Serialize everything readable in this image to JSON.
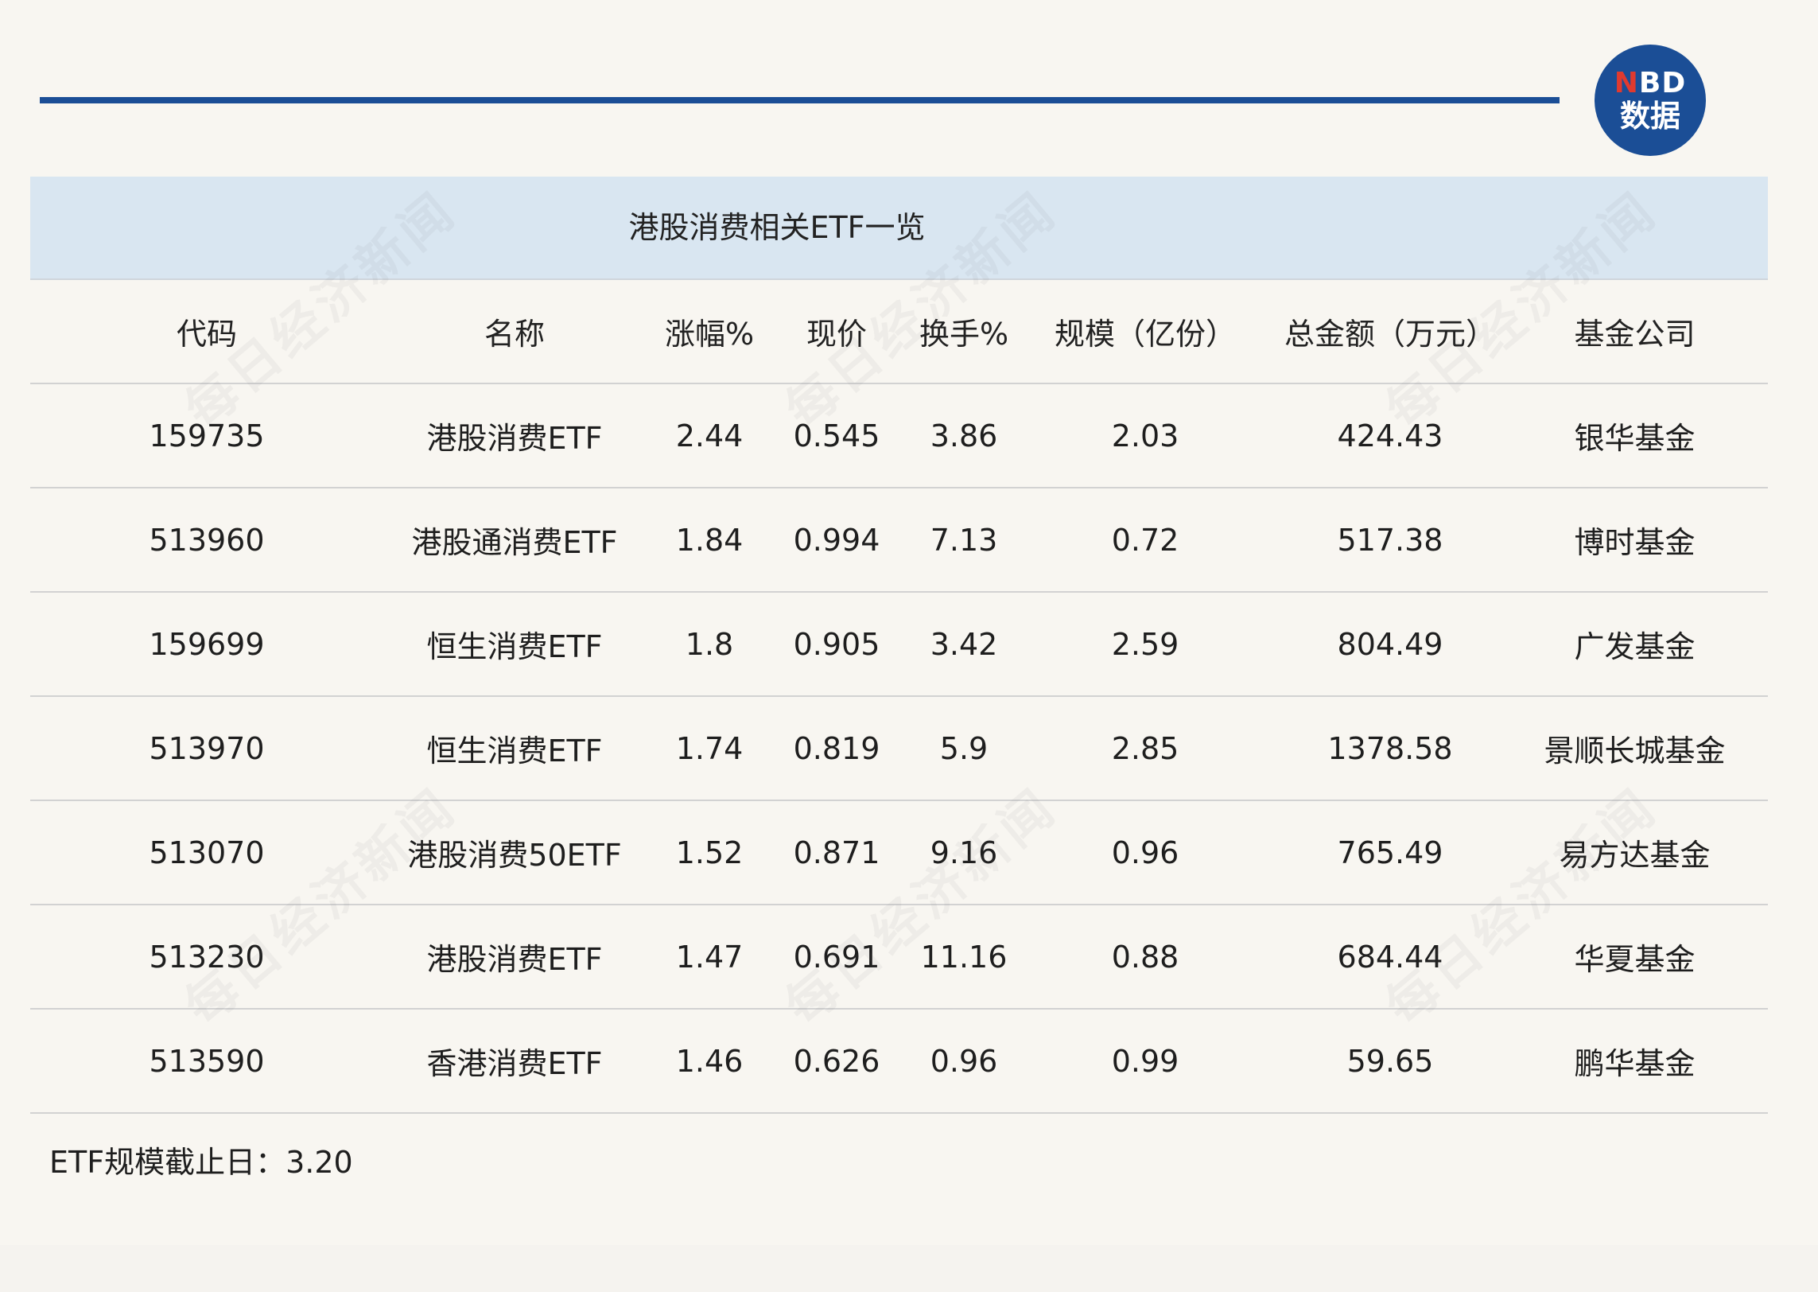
{
  "logo": {
    "line1_n": "N",
    "line1_rest": "BD",
    "line2": "数据"
  },
  "table": {
    "title": "港股消费相关ETF一览",
    "headers": [
      "代码",
      "名称",
      "涨幅%",
      "现价",
      "换手%",
      "规模（亿份）",
      "总金额（万元）",
      "基金公司"
    ],
    "rows": [
      [
        "159735",
        "港股消费ETF",
        "2.44",
        "0.545",
        "3.86",
        "2.03",
        "424.43",
        "银华基金"
      ],
      [
        "513960",
        "港股通消费ETF",
        "1.84",
        "0.994",
        "7.13",
        "0.72",
        "517.38",
        "博时基金"
      ],
      [
        "159699",
        "恒生消费ETF",
        "1.8",
        "0.905",
        "3.42",
        "2.59",
        "804.49",
        "广发基金"
      ],
      [
        "513970",
        "恒生消费ETF",
        "1.74",
        "0.819",
        "5.9",
        "2.85",
        "1378.58",
        "景顺长城基金"
      ],
      [
        "513070",
        "港股消费50ETF",
        "1.52",
        "0.871",
        "9.16",
        "0.96",
        "765.49",
        "易方达基金"
      ],
      [
        "513230",
        "港股消费ETF",
        "1.47",
        "0.691",
        "11.16",
        "0.88",
        "684.44",
        "华夏基金"
      ],
      [
        "513590",
        "香港消费ETF",
        "1.46",
        "0.626",
        "0.96",
        "0.99",
        "59.65",
        "鹏华基金"
      ]
    ]
  },
  "footnote": "ETF规模截止日：3.20",
  "watermark_text": "每日经济新闻",
  "colors": {
    "accent": "#1b4e96",
    "logo_n": "#e03a2f",
    "title_band": "#d9e6f1",
    "background": "#f8f6f1"
  }
}
